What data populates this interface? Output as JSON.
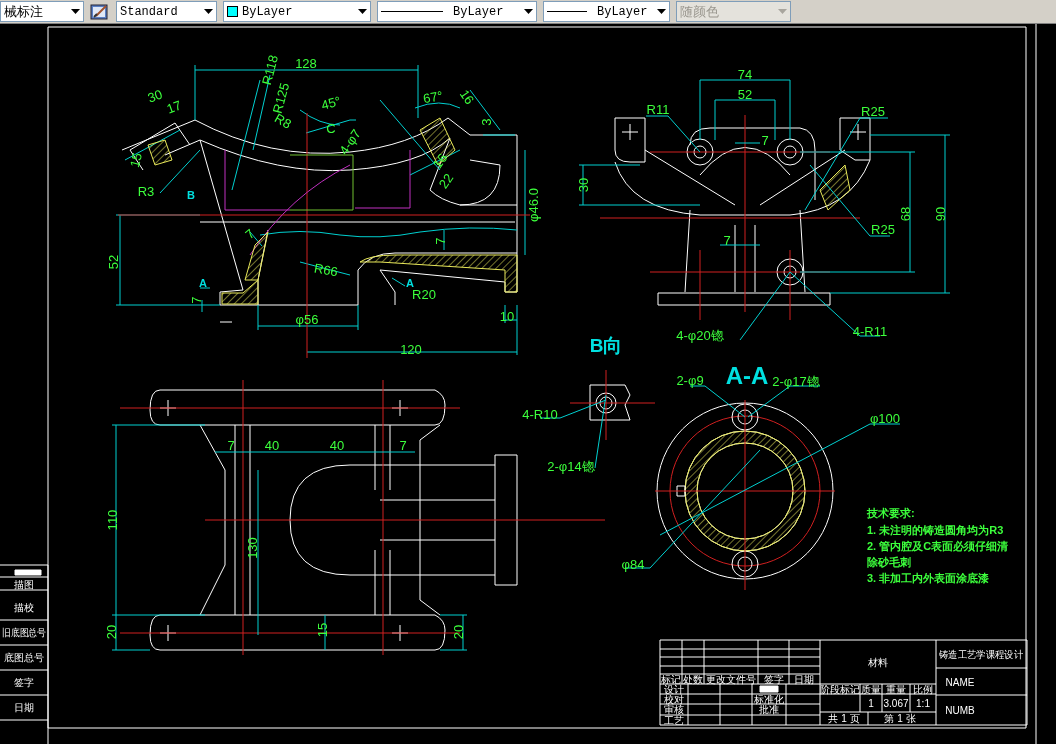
{
  "toolbar": {
    "dropdowns": [
      {
        "kind": "text",
        "value": "械标注",
        "disabled": false
      },
      {
        "kind": "style",
        "value": "Standard",
        "disabled": false
      },
      {
        "kind": "color",
        "value": "ByLayer",
        "color": "#00ffff",
        "disabled": false
      },
      {
        "kind": "linetype",
        "value": "ByLayer",
        "disabled": false
      },
      {
        "kind": "linetype",
        "value": "ByLayer",
        "disabled": false
      },
      {
        "kind": "text",
        "value": "随颜色",
        "disabled": true
      }
    ]
  },
  "drawing": {
    "front_view": {
      "annotations": [
        {
          "kind": "dimension",
          "text": "128"
        },
        {
          "kind": "dimension",
          "text": "R118"
        },
        {
          "kind": "dimension",
          "text": "R125"
        },
        {
          "kind": "dimension",
          "text": "30"
        },
        {
          "kind": "dimension",
          "text": "17"
        },
        {
          "kind": "dimension",
          "text": "15"
        },
        {
          "kind": "dimension",
          "text": "R3"
        },
        {
          "kind": "marker",
          "text": "B"
        },
        {
          "kind": "dimension",
          "text": "R8"
        },
        {
          "kind": "dimension",
          "text": "45°"
        },
        {
          "kind": "dimension",
          "text": "C"
        },
        {
          "kind": "dimension",
          "text": "4-φ7"
        },
        {
          "kind": "dimension",
          "text": "67°"
        },
        {
          "kind": "dimension",
          "text": "16"
        },
        {
          "kind": "dimension",
          "text": "3"
        },
        {
          "kind": "dimension",
          "text": "16"
        },
        {
          "kind": "dimension",
          "text": "22"
        },
        {
          "kind": "dimension",
          "text": "φ46.0"
        },
        {
          "kind": "dimension",
          "text": "52"
        },
        {
          "kind": "dimension",
          "text": "7"
        },
        {
          "kind": "dimension",
          "text": "R66"
        },
        {
          "kind": "dimension",
          "text": "7"
        },
        {
          "kind": "marker",
          "text": "A"
        },
        {
          "kind": "dimension",
          "text": "7"
        },
        {
          "kind": "marker",
          "text": "A"
        },
        {
          "kind": "dimension",
          "text": "R20"
        },
        {
          "kind": "dimension",
          "text": "φ56"
        },
        {
          "kind": "dimension",
          "text": "10"
        },
        {
          "kind": "dimension",
          "text": "120"
        }
      ]
    },
    "side_view": {
      "annotations": [
        {
          "kind": "dimension",
          "text": "74"
        },
        {
          "kind": "dimension",
          "text": "52"
        },
        {
          "kind": "dimension",
          "text": "R11"
        },
        {
          "kind": "dimension",
          "text": "R25"
        },
        {
          "kind": "dimension",
          "text": "7"
        },
        {
          "kind": "dimension",
          "text": "30"
        },
        {
          "kind": "dimension",
          "text": "R25"
        },
        {
          "kind": "dimension",
          "text": "68"
        },
        {
          "kind": "dimension",
          "text": "90"
        },
        {
          "kind": "dimension",
          "text": "7"
        },
        {
          "kind": "dimension",
          "text": "4-φ20锪"
        },
        {
          "kind": "dimension",
          "text": "4-R11"
        }
      ]
    },
    "b_view": {
      "title": "B向",
      "annotations": [
        {
          "kind": "dimension",
          "text": "4-R10"
        },
        {
          "kind": "dimension",
          "text": "2-φ14锪"
        }
      ]
    },
    "section_view": {
      "title": "A-A",
      "annotations": [
        {
          "kind": "dimension",
          "text": "2-φ9"
        },
        {
          "kind": "dimension",
          "text": "2-φ17锪"
        },
        {
          "kind": "dimension",
          "text": "φ100"
        },
        {
          "kind": "dimension",
          "text": "φ84"
        }
      ]
    },
    "top_view": {
      "annotations": [
        {
          "kind": "dimension",
          "text": "7"
        },
        {
          "kind": "dimension",
          "text": "40"
        },
        {
          "kind": "dimension",
          "text": "40"
        },
        {
          "kind": "dimension",
          "text": "7"
        },
        {
          "kind": "dimension",
          "text": "110"
        },
        {
          "kind": "dimension",
          "text": "130"
        },
        {
          "kind": "dimension",
          "text": "20"
        },
        {
          "kind": "dimension",
          "text": "15"
        },
        {
          "kind": "dimension",
          "text": "20"
        }
      ]
    },
    "technical_requirements": {
      "heading": "技术要求:",
      "items": [
        "1. 未注明的铸造圆角均为R3",
        "2. 管内腔及C表面必须仔细清",
        "除砂毛刺",
        "3. 非加工内外表面涂底漆"
      ]
    },
    "title_block": {
      "cells": [
        "标记",
        "处数",
        "更改文件号",
        "签字",
        "日期",
        "设计",
        "校对",
        "审核",
        "工艺",
        "标准化",
        "批准",
        "材料",
        "阶段标记",
        "质量",
        "重量",
        "比例",
        "1",
        "3.067",
        "1:1",
        "共 1 页",
        "第 1 张",
        "铸造工艺学课程设计",
        "NAME",
        "NUMB"
      ]
    },
    "side_strip": {
      "labels": [
        "描图",
        "描校",
        "旧底图总号",
        "底图总号",
        "签字",
        "日期"
      ]
    }
  }
}
